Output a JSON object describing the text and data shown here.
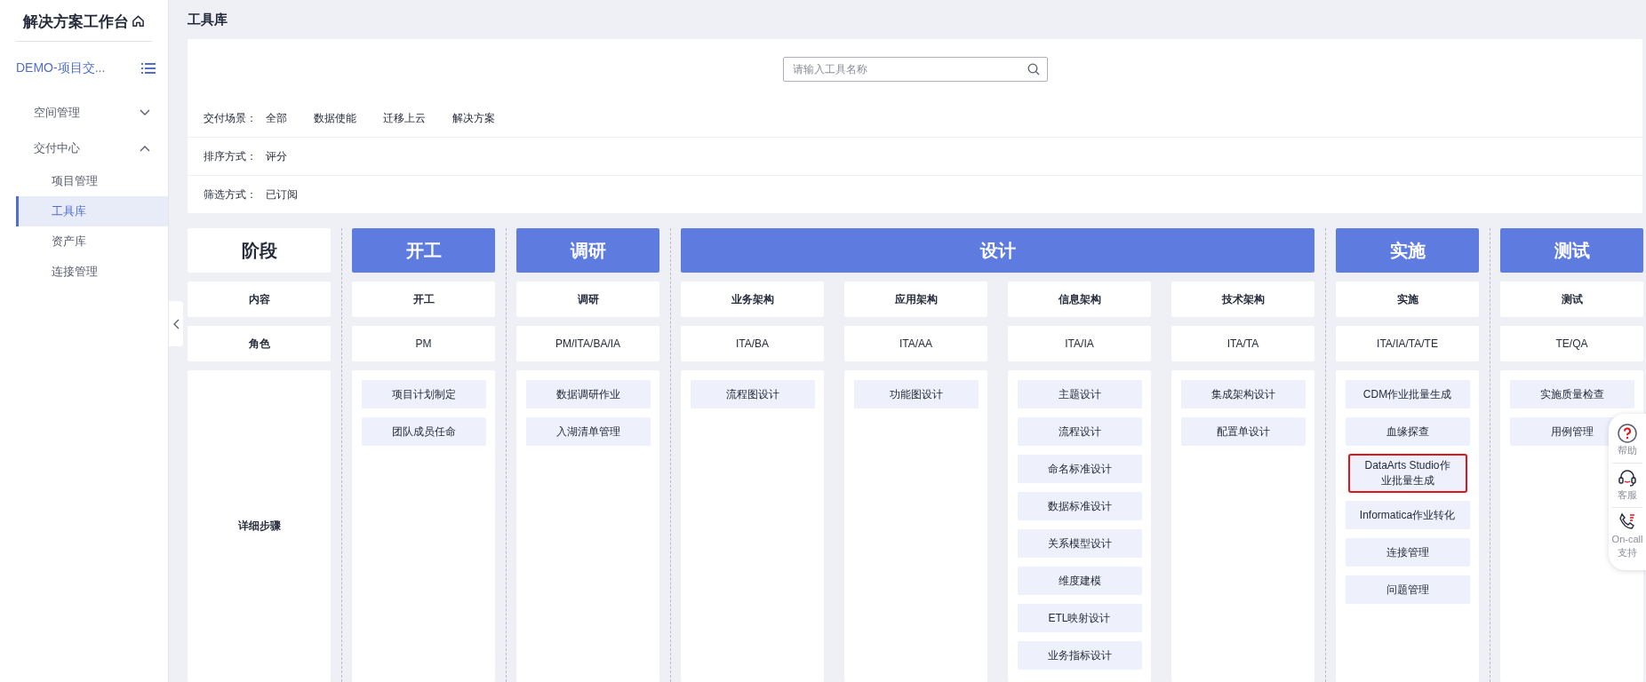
{
  "sidebar": {
    "title": "解决方案工作台",
    "project": "DEMO-项目交...",
    "groups": [
      {
        "label": "空间管理",
        "expanded": false
      },
      {
        "label": "交付中心",
        "expanded": true,
        "children": [
          {
            "label": "项目管理",
            "selected": false
          },
          {
            "label": "工具库",
            "selected": true
          },
          {
            "label": "资产库",
            "selected": false
          },
          {
            "label": "连接管理",
            "selected": false
          }
        ]
      }
    ]
  },
  "page_title": "工具库",
  "search": {
    "placeholder": "请输入工具名称"
  },
  "filters": [
    {
      "label": "交付场景：",
      "options": [
        "全部",
        "数据使能",
        "迁移上云",
        "解决方案"
      ]
    },
    {
      "label": "排序方式：",
      "options": [
        "评分"
      ]
    },
    {
      "label": "筛选方式：",
      "options": [
        "已订阅"
      ]
    }
  ],
  "row_labels": {
    "stage": "阶段",
    "content": "内容",
    "role": "角色",
    "steps": "详细步骤"
  },
  "stages": [
    {
      "name": "开工",
      "columns": [
        {
          "content": "开工",
          "role": "PM",
          "steps": [
            {
              "label": "项目计划制定",
              "highlighted": false
            },
            {
              "label": "团队成员任命",
              "highlighted": false
            }
          ]
        }
      ]
    },
    {
      "name": "调研",
      "columns": [
        {
          "content": "调研",
          "role": "PM/ITA/BA/IA",
          "steps": [
            {
              "label": "数据调研作业",
              "highlighted": false
            },
            {
              "label": "入湖清单管理",
              "highlighted": false
            }
          ]
        }
      ]
    },
    {
      "name": "设计",
      "columns": [
        {
          "content": "业务架构",
          "role": "ITA/BA",
          "steps": [
            {
              "label": "流程图设计",
              "highlighted": false
            }
          ]
        },
        {
          "content": "应用架构",
          "role": "ITA/AA",
          "steps": [
            {
              "label": "功能图设计",
              "highlighted": false
            }
          ]
        },
        {
          "content": "信息架构",
          "role": "ITA/IA",
          "steps": [
            {
              "label": "主题设计",
              "highlighted": false
            },
            {
              "label": "流程设计",
              "highlighted": false
            },
            {
              "label": "命名标准设计",
              "highlighted": false
            },
            {
              "label": "数据标准设计",
              "highlighted": false
            },
            {
              "label": "关系模型设计",
              "highlighted": false
            },
            {
              "label": "维度建模",
              "highlighted": false
            },
            {
              "label": "ETL映射设计",
              "highlighted": false
            },
            {
              "label": "业务指标设计",
              "highlighted": false
            }
          ]
        },
        {
          "content": "技术架构",
          "role": "ITA/TA",
          "steps": [
            {
              "label": "集成架构设计",
              "highlighted": false
            },
            {
              "label": "配置单设计",
              "highlighted": false
            }
          ]
        }
      ]
    },
    {
      "name": "实施",
      "columns": [
        {
          "content": "实施",
          "role": "ITA/IA/TA/TE",
          "steps": [
            {
              "label": "CDM作业批量生成",
              "highlighted": false
            },
            {
              "label": "血缘探查",
              "highlighted": false
            },
            {
              "label": "DataArts Studio作业批量生成",
              "highlighted": true
            },
            {
              "label": "Informatica作业转化",
              "highlighted": false
            },
            {
              "label": "连接管理",
              "highlighted": false
            },
            {
              "label": "问题管理",
              "highlighted": false
            }
          ]
        }
      ]
    },
    {
      "name": "测试",
      "columns": [
        {
          "content": "测试",
          "role": "TE/QA",
          "steps": [
            {
              "label": "实施质量检查",
              "highlighted": false
            },
            {
              "label": "用例管理",
              "highlighted": false
            }
          ]
        }
      ]
    }
  ],
  "help_panel": [
    {
      "kind": "help",
      "label": "帮助"
    },
    {
      "kind": "service",
      "label": "客服"
    },
    {
      "kind": "oncall",
      "label": "On-call\n支持"
    }
  ]
}
